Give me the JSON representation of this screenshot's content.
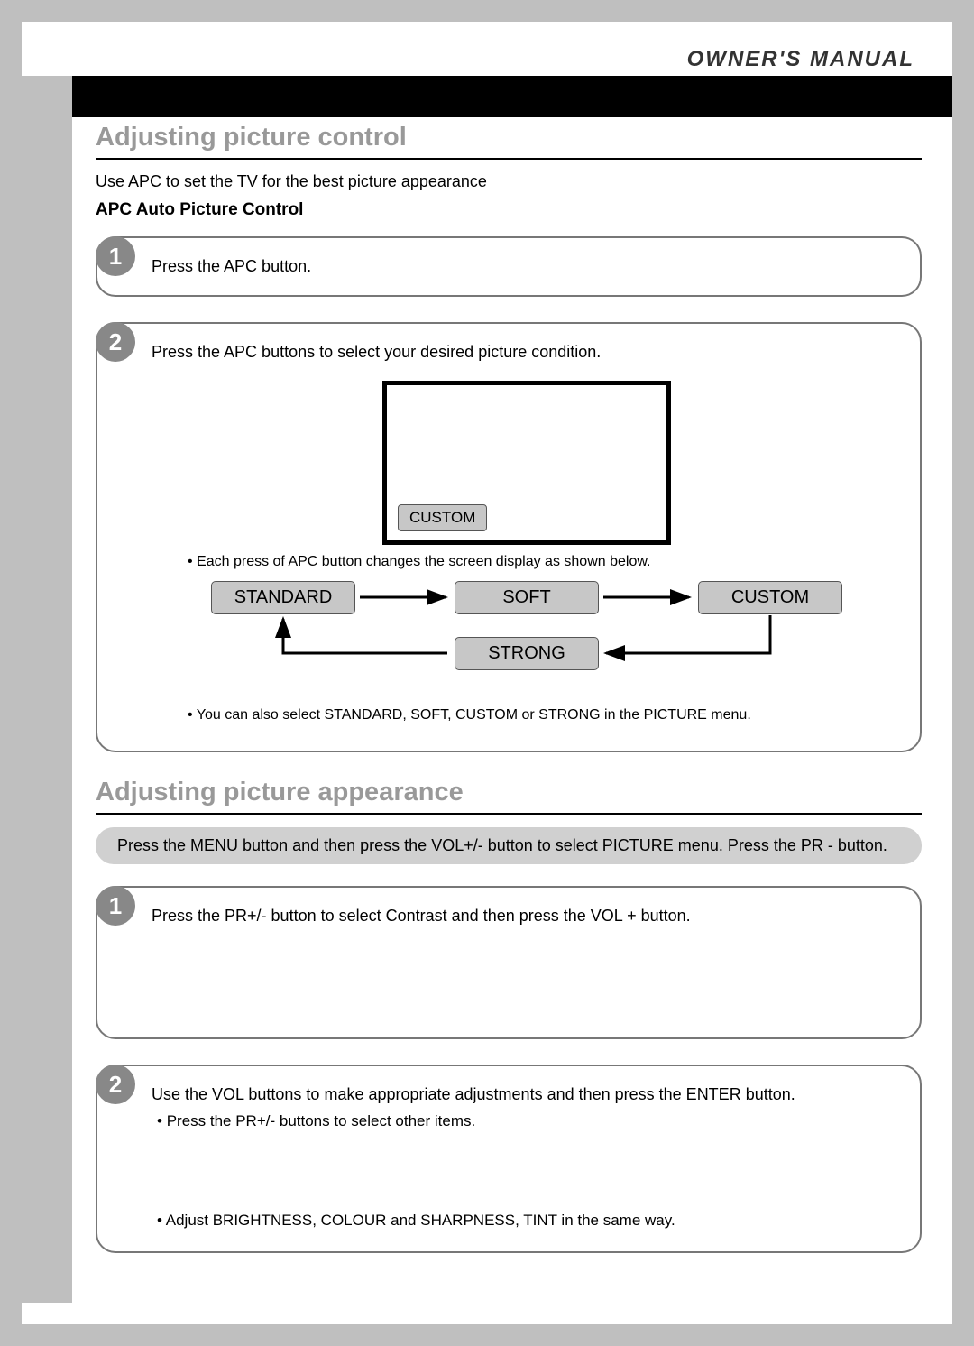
{
  "header": {
    "label": "OWNER'S MANUAL"
  },
  "section1": {
    "title": "Adjusting picture control",
    "intro": "Use APC to set the TV for the best picture appearance",
    "subhead": "APC Auto Picture Control",
    "step1": {
      "num": "1",
      "text": "Press the APC button."
    },
    "step2": {
      "num": "2",
      "text": "Press the APC buttons to select your desired picture condition.",
      "tv_label": "CUSTOM",
      "bullet1": "Each press of APC button changes the screen display as shown below.",
      "bullet2": "You can also select STANDARD, SOFT, CUSTOM or STRONG in the PICTURE menu.",
      "modes": {
        "standard": "STANDARD",
        "soft": "SOFT",
        "custom": "CUSTOM",
        "strong": "STRONG"
      }
    }
  },
  "section2": {
    "title": "Adjusting picture appearance",
    "chip": "Press the MENU button and then press the VOL+/- button to select PICTURE menu. Press the PR - button.",
    "step1": {
      "num": "1",
      "text": "Press the PR+/- button to select Contrast and then press the VOL + button."
    },
    "step2": {
      "num": "2",
      "text": "Use the VOL buttons to make appropriate adjustments and then press the ENTER button.",
      "bullet1": "Press the PR+/- buttons to select other items.",
      "bullet2": "Adjust BRIGHTNESS, COLOUR and SHARPNESS, TINT in the same way."
    }
  }
}
